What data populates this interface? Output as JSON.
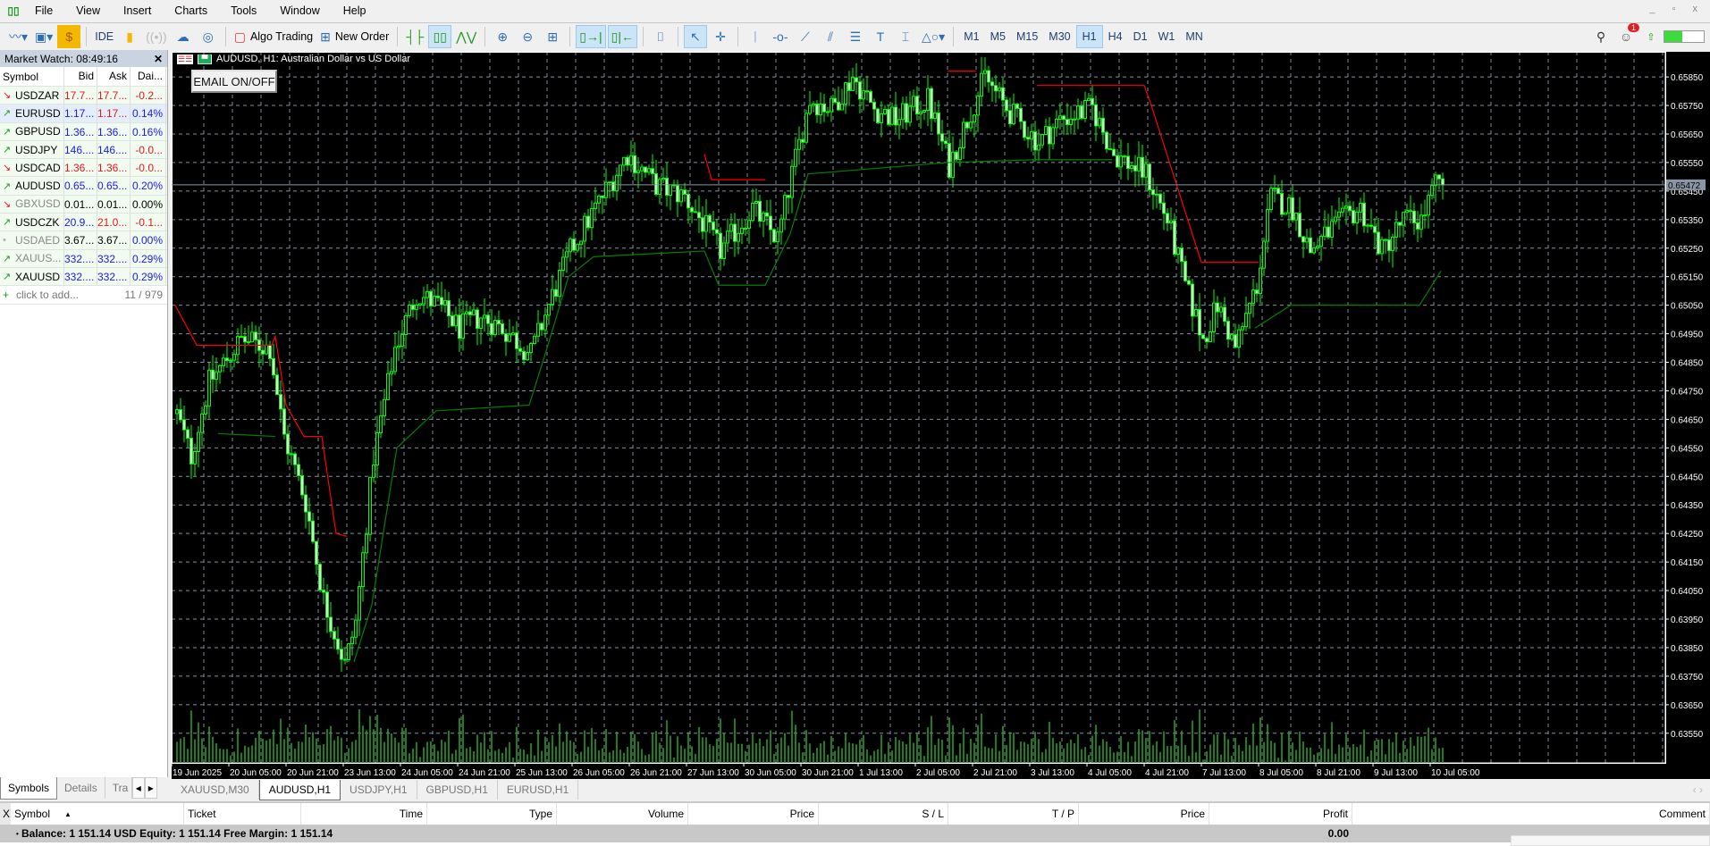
{
  "menu": {
    "items": [
      "File",
      "View",
      "Insert",
      "Charts",
      "Tools",
      "Window",
      "Help"
    ]
  },
  "toolbar": {
    "ide": "IDE",
    "algo_trading": "Algo Trading",
    "new_order": "New Order",
    "timeframes": [
      "M1",
      "M5",
      "M15",
      "M30",
      "H1",
      "H4",
      "D1",
      "W1",
      "MN"
    ],
    "active_timeframe": "H1",
    "notification_count": "1"
  },
  "market_watch": {
    "title": "Market Watch: 08:49:16",
    "columns": [
      "Symbol",
      "Bid",
      "Ask",
      "Dai..."
    ],
    "rows": [
      {
        "symbol": "USDZAR",
        "dir": "down",
        "bid": "17.7...",
        "ask": "17.7...",
        "daily": "-0.2...",
        "bid_c": "#e8141b",
        "ask_c": "#e8141b",
        "daily_c": "#e8141b"
      },
      {
        "symbol": "EURUSD",
        "dir": "up",
        "bid": "1.17...",
        "ask": "1.17...",
        "daily": "0.14%",
        "bid_c": "#1a1ae6",
        "ask_c": "#e8141b",
        "daily_c": "#1a1ae6",
        "selected": true
      },
      {
        "symbol": "GBPUSD",
        "dir": "up",
        "bid": "1.36...",
        "ask": "1.36...",
        "daily": "0.16%",
        "bid_c": "#1a1ae6",
        "ask_c": "#1a1ae6",
        "daily_c": "#1a1ae6"
      },
      {
        "symbol": "USDJPY",
        "dir": "up",
        "bid": "146....",
        "ask": "146....",
        "daily": "-0.0...",
        "bid_c": "#1a1ae6",
        "ask_c": "#1a1ae6",
        "daily_c": "#e8141b"
      },
      {
        "symbol": "USDCAD",
        "dir": "down",
        "bid": "1.36...",
        "ask": "1.36...",
        "daily": "-0.0...",
        "bid_c": "#e8141b",
        "ask_c": "#e8141b",
        "daily_c": "#e8141b"
      },
      {
        "symbol": "AUDUSD",
        "dir": "up",
        "bid": "0.65...",
        "ask": "0.65...",
        "daily": "0.20%",
        "bid_c": "#1a1ae6",
        "ask_c": "#1a1ae6",
        "daily_c": "#1a1ae6"
      },
      {
        "symbol": "GBXUSD",
        "dir": "down",
        "bid": "0.01...",
        "ask": "0.01...",
        "daily": "0.00%",
        "bid_c": "#000",
        "ask_c": "#000",
        "daily_c": "#000",
        "muted": true
      },
      {
        "symbol": "USDCZK",
        "dir": "up",
        "bid": "20.9...",
        "ask": "21.0...",
        "daily": "-0.1...",
        "bid_c": "#1a1ae6",
        "ask_c": "#e8141b",
        "daily_c": "#e8141b"
      },
      {
        "symbol": "USDAED",
        "dir": "none",
        "bid": "3.67...",
        "ask": "3.67...",
        "daily": "0.00%",
        "bid_c": "#000",
        "ask_c": "#000",
        "daily_c": "#1a1ae6",
        "muted": true
      },
      {
        "symbol": "XAUUS...",
        "dir": "up",
        "bid": "332....",
        "ask": "332....",
        "daily": "0.29%",
        "bid_c": "#1a1ae6",
        "ask_c": "#1a1ae6",
        "daily_c": "#1a1ae6",
        "muted": true
      },
      {
        "symbol": "XAUUSD",
        "dir": "up",
        "bid": "332....",
        "ask": "332....",
        "daily": "0.29%",
        "bid_c": "#1a1ae6",
        "ask_c": "#1a1ae6",
        "daily_c": "#1a1ae6"
      }
    ],
    "add_label": "click to add...",
    "count": "11 / 979",
    "tabs": [
      "Symbols",
      "Details",
      "Tra"
    ]
  },
  "chart": {
    "title": "AUDUSD, H1:  Australian Dollar vs US Dollar",
    "email_button": "EMAIL ON/OFF",
    "tabs": [
      "XAUUSD,M30",
      "AUDUSD,H1",
      "USDJPY,H1",
      "GBPUSD,H1",
      "EURUSD,H1"
    ],
    "active_tab": "AUDUSD,H1"
  },
  "chart_data": {
    "type": "candlestick",
    "symbol": "AUDUSD",
    "timeframe": "H1",
    "ylim": [
      0.63446,
      0.65938
    ],
    "y_ticks": [
      "0.65850",
      "0.65750",
      "0.65650",
      "0.65550",
      "0.65450",
      "0.65350",
      "0.65250",
      "0.65150",
      "0.65050",
      "0.64950",
      "0.64850",
      "0.64750",
      "0.64650",
      "0.64550",
      "0.64450",
      "0.64350",
      "0.64250",
      "0.64150",
      "0.64050",
      "0.63950",
      "0.63850",
      "0.63750",
      "0.63650",
      "0.63550"
    ],
    "x_ticks": [
      "19 Jun 2025",
      "20 Jun 05:00",
      "20 Jun 21:00",
      "23 Jun 13:00",
      "24 Jun 05:00",
      "24 Jun 21:00",
      "25 Jun 13:00",
      "26 Jun 05:00",
      "26 Jun 21:00",
      "27 Jun 13:00",
      "30 Jun 05:00",
      "30 Jun 21:00",
      "1 Jul 13:00",
      "2 Jul 05:00",
      "2 Jul 21:00",
      "3 Jul 13:00",
      "4 Jul 05:00",
      "4 Jul 21:00",
      "7 Jul 13:00",
      "8 Jul 05:00",
      "8 Jul 21:00",
      "9 Jul 13:00",
      "10 Jul 05:00"
    ],
    "bars_per_x_tick": 16,
    "bar_count": 355,
    "current_price": "0.65472",
    "grid": true,
    "bull_color": "#00ff00",
    "bear_color": "#00ff00",
    "grid_color": "#8090a0",
    "close_path": [
      [
        0,
        0.6467
      ],
      [
        4,
        0.6452
      ],
      [
        9,
        0.6478
      ],
      [
        18,
        0.6493
      ],
      [
        26,
        0.649
      ],
      [
        30,
        0.6459
      ],
      [
        36,
        0.6436
      ],
      [
        41,
        0.6402
      ],
      [
        47,
        0.6379
      ],
      [
        50,
        0.6394
      ],
      [
        55,
        0.6452
      ],
      [
        61,
        0.649
      ],
      [
        67,
        0.6509
      ],
      [
        73,
        0.6505
      ],
      [
        79,
        0.6497
      ],
      [
        85,
        0.6501
      ],
      [
        91,
        0.6497
      ],
      [
        99,
        0.6488
      ],
      [
        104,
        0.6505
      ],
      [
        110,
        0.6524
      ],
      [
        117,
        0.6539
      ],
      [
        126,
        0.6558
      ],
      [
        134,
        0.6547
      ],
      [
        142,
        0.6543
      ],
      [
        148,
        0.6532
      ],
      [
        152,
        0.6524
      ],
      [
        161,
        0.6539
      ],
      [
        168,
        0.6528
      ],
      [
        172,
        0.6551
      ],
      [
        177,
        0.6577
      ],
      [
        183,
        0.6574
      ],
      [
        189,
        0.6585
      ],
      [
        195,
        0.6574
      ],
      [
        201,
        0.657
      ],
      [
        210,
        0.6577
      ],
      [
        216,
        0.6554
      ],
      [
        221,
        0.657
      ],
      [
        226,
        0.6585
      ],
      [
        232,
        0.6574
      ],
      [
        241,
        0.6562
      ],
      [
        247,
        0.657
      ],
      [
        256,
        0.6574
      ],
      [
        262,
        0.6558
      ],
      [
        271,
        0.6551
      ],
      [
        277,
        0.6535
      ],
      [
        282,
        0.6512
      ],
      [
        287,
        0.6493
      ],
      [
        291,
        0.6505
      ],
      [
        296,
        0.649
      ],
      [
        302,
        0.6512
      ],
      [
        306,
        0.6543
      ],
      [
        312,
        0.6539
      ],
      [
        317,
        0.6524
      ],
      [
        323,
        0.6532
      ],
      [
        331,
        0.6539
      ],
      [
        337,
        0.6524
      ],
      [
        343,
        0.6535
      ],
      [
        348,
        0.6535
      ],
      [
        352,
        0.6547
      ],
      [
        354,
        0.65472
      ]
    ],
    "indicator_resistance": {
      "color": "#ff0000",
      "segments": [
        [
          [
            0,
            0.6505
          ],
          [
            6,
            0.6491
          ],
          [
            27,
            0.6491
          ],
          [
            28,
            0.6494
          ],
          [
            31,
            0.647
          ],
          [
            36,
            0.6459
          ],
          [
            41,
            0.6459
          ],
          [
            45,
            0.6425
          ],
          [
            48,
            0.6424
          ]
        ],
        [
          [
            148,
            0.6558
          ],
          [
            150,
            0.6549
          ],
          [
            165,
            0.6549
          ]
        ],
        [
          [
            216,
            0.6587
          ],
          [
            224,
            0.6587
          ]
        ],
        [
          [
            241,
            0.6582
          ],
          [
            271,
            0.6582
          ],
          [
            273,
            0.6575
          ],
          [
            287,
            0.652
          ],
          [
            303,
            0.652
          ]
        ]
      ]
    },
    "indicator_support": {
      "color": "#008000",
      "segments": [
        [
          [
            12,
            0.646
          ],
          [
            28,
            0.6459
          ]
        ],
        [
          [
            50,
            0.638
          ],
          [
            55,
            0.64
          ],
          [
            62,
            0.6455
          ],
          [
            73,
            0.6468
          ],
          [
            99,
            0.647
          ],
          [
            104,
            0.649
          ],
          [
            110,
            0.6515
          ],
          [
            117,
            0.6522
          ],
          [
            148,
            0.6524
          ],
          [
            152,
            0.6512
          ],
          [
            165,
            0.6512
          ],
          [
            172,
            0.653
          ],
          [
            177,
            0.6551
          ],
          [
            216,
            0.6555
          ],
          [
            241,
            0.6556
          ],
          [
            262,
            0.6556
          ]
        ],
        [
          [
            302,
            0.6497
          ],
          [
            312,
            0.6505
          ],
          [
            348,
            0.6505
          ],
          [
            354,
            0.6517
          ]
        ]
      ]
    }
  },
  "toolbox": {
    "columns": [
      "Symbol",
      "Ticket",
      "Time",
      "Type",
      "Volume",
      "Price",
      "S / L",
      "T / P",
      "Price",
      "Profit",
      "Comment"
    ],
    "balance_text": "Balance: 1 151.14 USD  Equity: 1 151.14  Free Margin: 1 151.14",
    "profit": "0.00",
    "close": "X"
  }
}
